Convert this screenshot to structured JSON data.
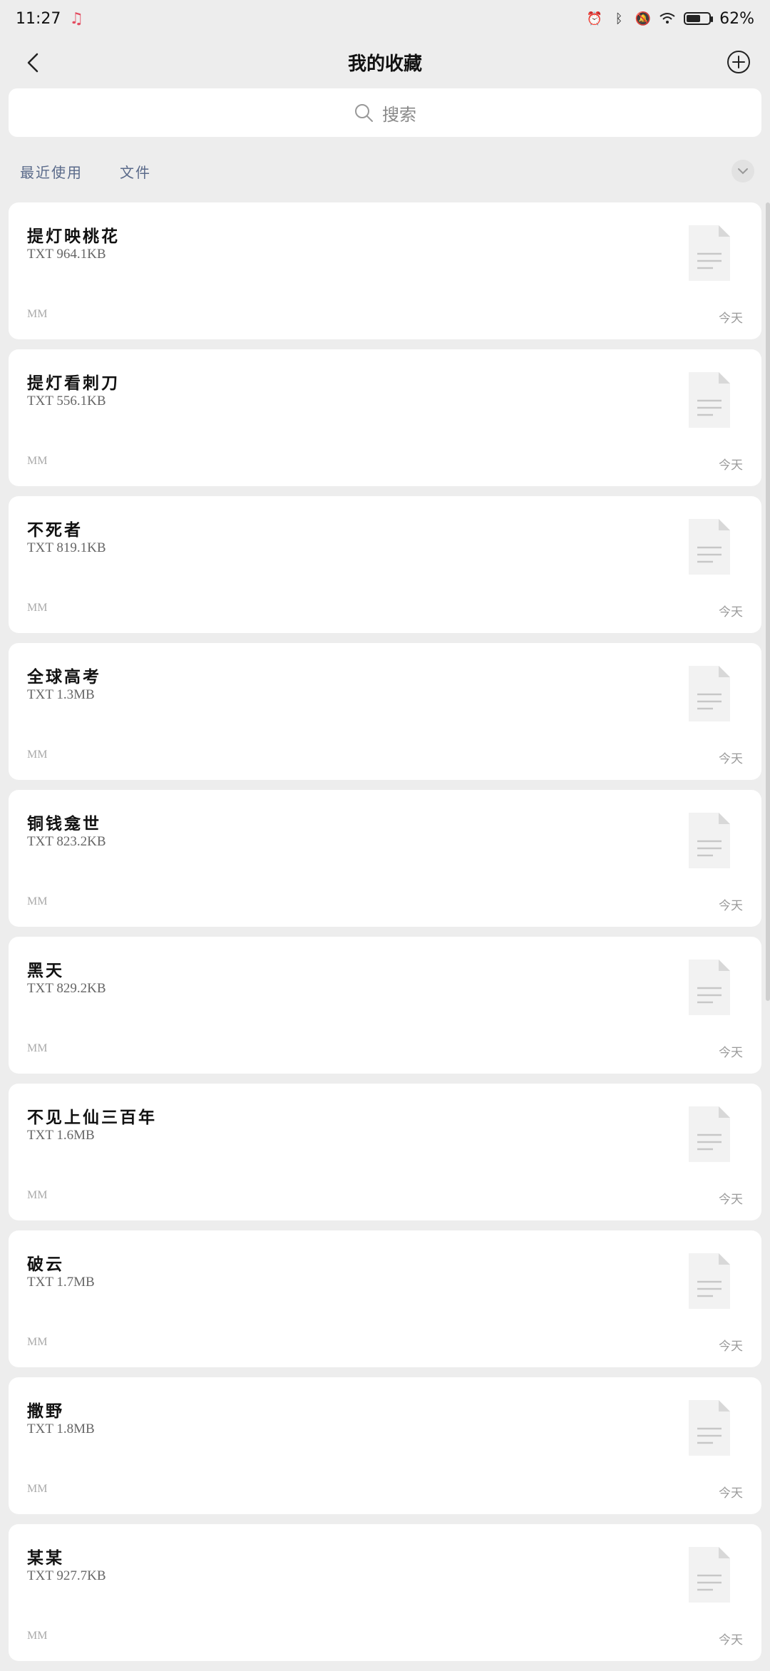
{
  "status": {
    "time": "11:27",
    "battery": "62%",
    "battery_level": 0.62
  },
  "header": {
    "title": "我的收藏"
  },
  "search": {
    "placeholder": "搜索"
  },
  "filters": {
    "tabs": [
      "最近使用",
      "文件"
    ]
  },
  "files": [
    {
      "name": "提灯映桃花",
      "type": "TXT",
      "size": "964.1KB",
      "source": "MM",
      "date": "今天"
    },
    {
      "name": "提灯看刺刀",
      "type": "TXT",
      "size": "556.1KB",
      "source": "MM",
      "date": "今天"
    },
    {
      "name": "不死者",
      "type": "TXT",
      "size": "819.1KB",
      "source": "MM",
      "date": "今天"
    },
    {
      "name": "全球高考",
      "type": "TXT",
      "size": "1.3MB",
      "source": "MM",
      "date": "今天"
    },
    {
      "name": "铜钱龛世",
      "type": "TXT",
      "size": "823.2KB",
      "source": "MM",
      "date": "今天"
    },
    {
      "name": "黑天",
      "type": "TXT",
      "size": "829.2KB",
      "source": "MM",
      "date": "今天"
    },
    {
      "name": "不见上仙三百年",
      "type": "TXT",
      "size": "1.6MB",
      "source": "MM",
      "date": "今天"
    },
    {
      "name": "破云",
      "type": "TXT",
      "size": "1.7MB",
      "source": "MM",
      "date": "今天"
    },
    {
      "name": "撒野",
      "type": "TXT",
      "size": "1.8MB",
      "source": "MM",
      "date": "今天"
    },
    {
      "name": "某某",
      "type": "TXT",
      "size": "927.7KB",
      "source": "MM",
      "date": "今天"
    }
  ],
  "icons": {
    "back": "chevron-left-icon",
    "add": "plus-circle-icon",
    "search": "search-icon",
    "expand": "chevron-down-icon",
    "file": "document-icon"
  }
}
